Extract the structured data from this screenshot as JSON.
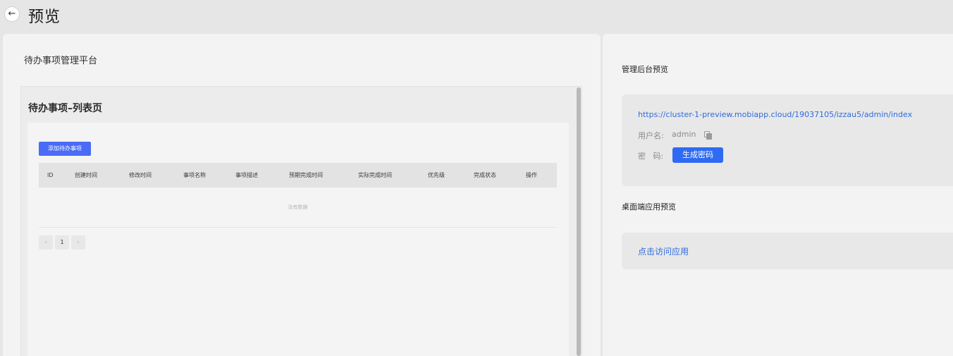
{
  "header": {
    "back_icon": "←",
    "title": "预览"
  },
  "left": {
    "platform_title": "待办事项管理平台",
    "app": {
      "page_title": "待办事项–列表页",
      "add_button": "添加待办事项",
      "columns": [
        "ID",
        "创建时间",
        "修改时间",
        "事项名称",
        "事项描述",
        "预期完成时间",
        "实际完成时间",
        "优先级",
        "完成状态",
        "操作"
      ],
      "empty_text": "没有数据",
      "pager": {
        "prev": "‹",
        "current": "1",
        "next": "›"
      }
    }
  },
  "right": {
    "admin_title": "管理后台预览",
    "admin_url": "https://cluster-1-preview.mobiapp.cloud/19037105/izzau5/admin/index",
    "username_label": "用户名:",
    "username_value": "admin",
    "password_label": "密   码:",
    "generate_password_button": "生成密码",
    "desktop_title": "桌面端应用预览",
    "visit_link": "点击访问应用"
  },
  "colors": {
    "primary": "#2f6bf2",
    "link": "#2f6bdc",
    "add_button": "#4a6bf5"
  }
}
